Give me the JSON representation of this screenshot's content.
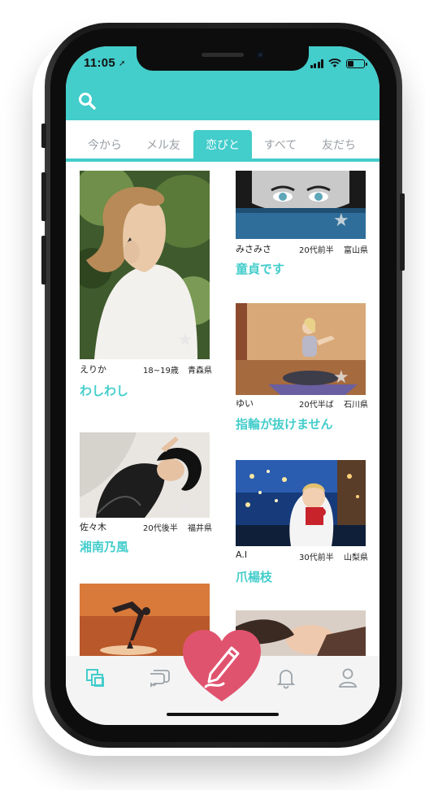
{
  "status_bar": {
    "time": "11:05",
    "location_glyph": "➚"
  },
  "header": {
    "search_icon": "search-icon",
    "color": "#43cdcb"
  },
  "tabs": [
    {
      "label": "今から",
      "active": false
    },
    {
      "label": "メル友",
      "active": false
    },
    {
      "label": "恋びと",
      "active": true
    },
    {
      "label": "すべて",
      "active": false
    },
    {
      "label": "友だち",
      "active": false
    }
  ],
  "cards": [
    {
      "name": "えりか",
      "age": "18~19歳",
      "region": "青森県",
      "message": "わしわし"
    },
    {
      "name": "みさみさ",
      "age": "20代前半",
      "region": "富山県",
      "message": "童貞です"
    },
    {
      "name": "ゆい",
      "age": "20代半ば",
      "region": "石川県",
      "message": "指輪が抜けません"
    },
    {
      "name": "佐々木",
      "age": "20代後半",
      "region": "福井県",
      "message": "湘南乃風"
    },
    {
      "name": "A.I",
      "age": "30代前半",
      "region": "山梨県",
      "message": "爪楊枝"
    }
  ],
  "bottom_nav": [
    "cards-icon",
    "chat-icon",
    "heart-pen-icon",
    "bell-icon",
    "profile-icon"
  ]
}
